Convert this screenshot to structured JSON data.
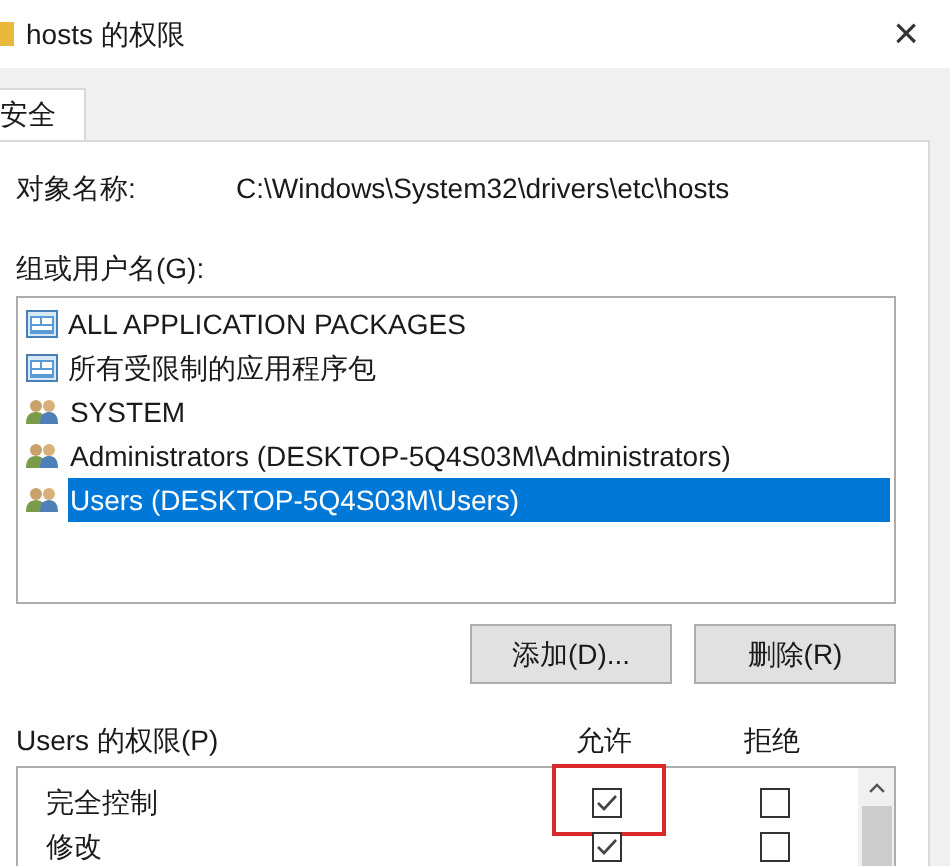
{
  "window": {
    "title": "hosts 的权限",
    "close": "×"
  },
  "tabs": [
    {
      "label": "安全",
      "selected": true
    }
  ],
  "object_name": {
    "label": "对象名称:",
    "value": "C:\\Windows\\System32\\drivers\\etc\\hosts"
  },
  "principals": {
    "label": "组或用户名(G):",
    "items": [
      {
        "kind": "package",
        "name": "ALL APPLICATION PACKAGES",
        "selected": false
      },
      {
        "kind": "package",
        "name": "所有受限制的应用程序包",
        "selected": false
      },
      {
        "kind": "group",
        "name": "SYSTEM",
        "selected": false
      },
      {
        "kind": "group",
        "name": "Administrators (DESKTOP-5Q4S03M\\Administrators)",
        "selected": false
      },
      {
        "kind": "group",
        "name": "Users (DESKTOP-5Q4S03M\\Users)",
        "selected": true
      }
    ]
  },
  "buttons": [
    "添加(D)...",
    "删除(R)"
  ],
  "permissions": {
    "label": "Users 的权限(P)",
    "columns": [
      "允许",
      "拒绝"
    ],
    "rows": [
      {
        "name": "完全控制",
        "allow": true,
        "deny": false,
        "highlighted": true
      },
      {
        "name": "修改",
        "allow": true,
        "deny": false,
        "highlighted": false
      }
    ]
  }
}
